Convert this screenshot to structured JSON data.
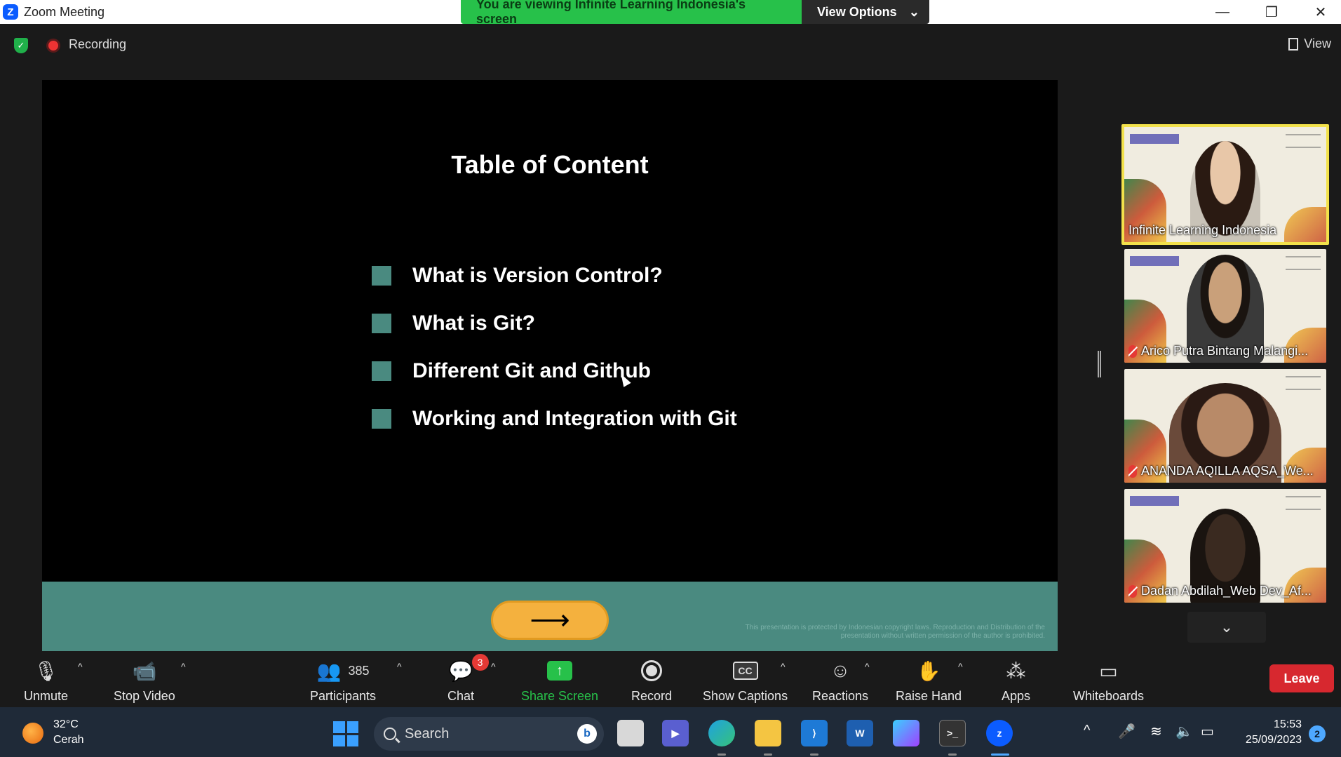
{
  "titlebar": {
    "app_title": "Zoom Meeting",
    "share_banner": "You are viewing Infinite Learning Indonesia's screen",
    "view_options": "View Options"
  },
  "header": {
    "recording_label": "Recording",
    "view_label": "View"
  },
  "slide": {
    "title": "Table of Content",
    "items": [
      "What is Version Control?",
      "What is Git?",
      "Different Git and Github",
      "Working and Integration with Git"
    ],
    "next_arrow": "⟶",
    "copyright": "This presentation is protected by Indonesian copyright laws. Reproduction and Distribution of the presentation without written permission of the author is prohibited."
  },
  "participants": [
    {
      "name": "Infinite Learning Indonesia",
      "muted": false,
      "active": true
    },
    {
      "name": "Arico Putra Bintang Malangi...",
      "muted": true,
      "active": false
    },
    {
      "name": "ANANDA AQILLA AQSA_We...",
      "muted": true,
      "active": false
    },
    {
      "name": "Dadan Abdilah_Web Dev_Af...",
      "muted": true,
      "active": false
    }
  ],
  "toolbar": {
    "unmute": "Unmute",
    "stop_video": "Stop Video",
    "participants": "Participants",
    "participants_count": "385",
    "chat": "Chat",
    "chat_badge": "3",
    "share_screen": "Share Screen",
    "record": "Record",
    "show_captions": "Show Captions",
    "reactions": "Reactions",
    "raise_hand": "Raise Hand",
    "apps": "Apps",
    "whiteboards": "Whiteboards",
    "leave": "Leave"
  },
  "taskbar": {
    "temperature": "32°C",
    "weather": "Cerah",
    "search_placeholder": "Search",
    "time": "15:53",
    "date": "25/09/2023",
    "notifications": "2"
  },
  "colors": {
    "zoom_blue": "#0b5cff",
    "share_green": "#27c14a",
    "leave_red": "#d7282f",
    "slide_teal": "#4a8a80",
    "slide_button": "#f4b13e"
  }
}
